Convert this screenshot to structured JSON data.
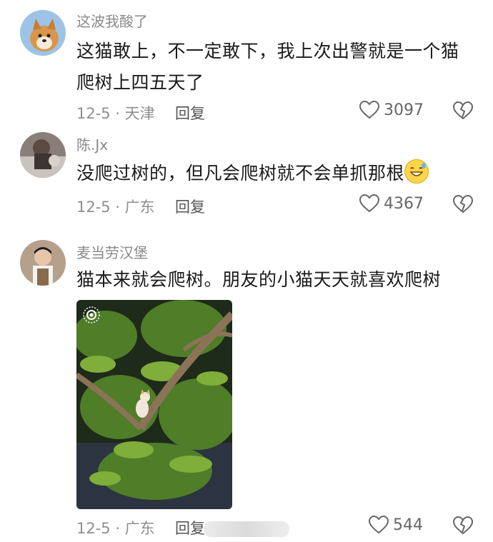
{
  "comments": [
    {
      "username": "这波我酸了",
      "text_lines": [
        "这猫敢上，不一定敢下，我上次出警就是一个猫",
        "爬树上四五天了"
      ],
      "date_location": "12-5 · 天津",
      "reply_label": "回复",
      "likes": "3097"
    },
    {
      "username": "陈.Jx",
      "text": "没爬过树的，但凡会爬树就不会单抓那根",
      "emoji": "grinning-sweat-emoji",
      "date_location": "12-5 · 广东",
      "reply_label": "回复",
      "likes": "4367"
    },
    {
      "username": "麦当劳汉堡",
      "text": "猫本来就会爬树。朋友的小猫天天就喜欢爬树",
      "date_location": "12-5 · 广东",
      "reply_label": "回复",
      "likes": "544"
    }
  ],
  "icons": {
    "like": "heart-icon",
    "dislike": "broken-heart-icon",
    "photo_badge": "live-photo-icon"
  },
  "colors": {
    "meta": "#8f8f8f",
    "text": "#1a1a1a",
    "username": "#8a8a8a"
  }
}
